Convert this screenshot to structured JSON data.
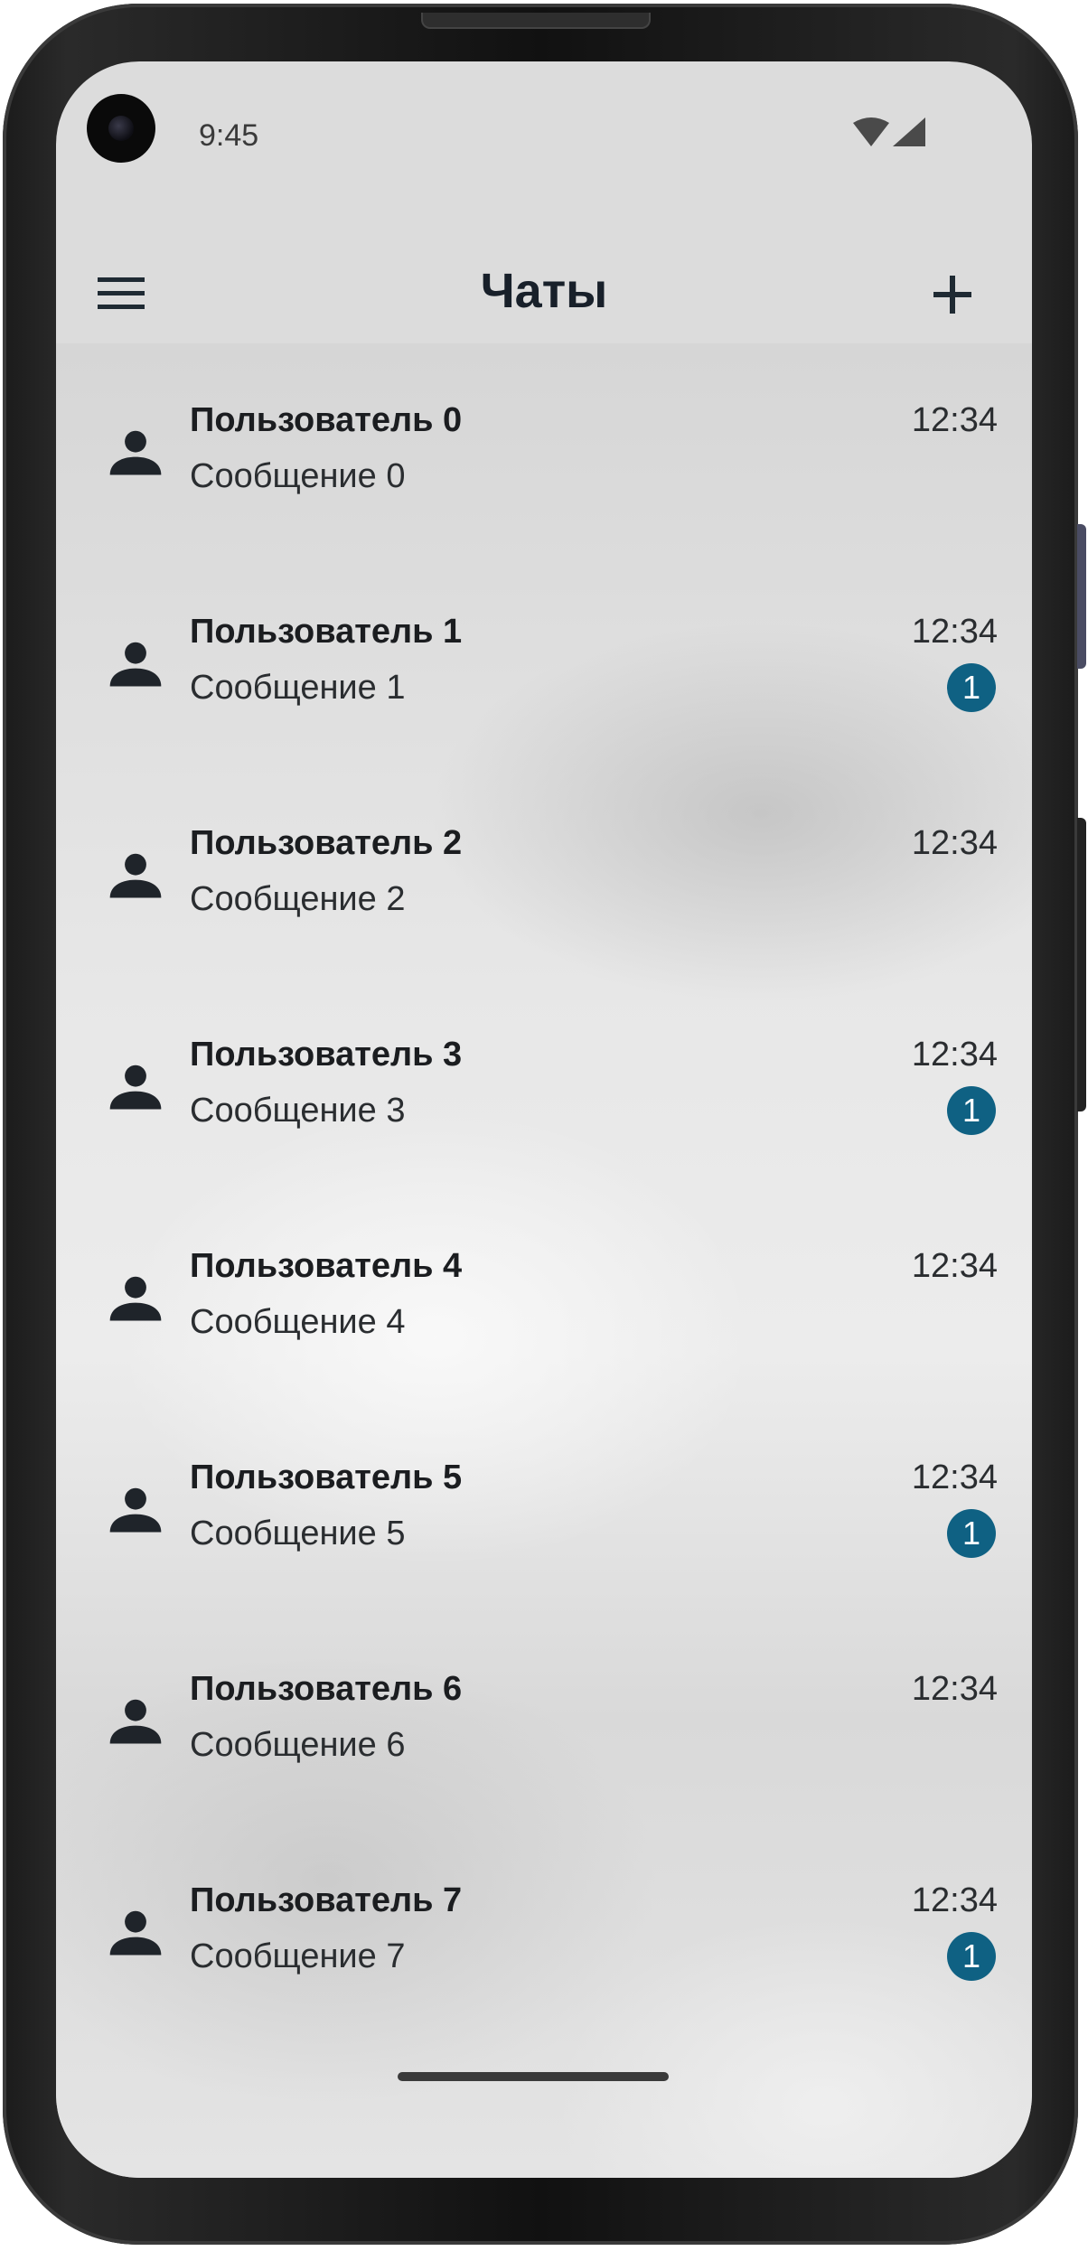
{
  "status_bar": {
    "time": "9:45"
  },
  "app_bar": {
    "title": "Чаты",
    "menu_icon": "menu-icon",
    "add_icon": "add-icon"
  },
  "colors": {
    "accent": "#0f6183",
    "title": "#18202a",
    "app_bar_bg": "#dcdcdc"
  },
  "chats": [
    {
      "name": "Пользователь 0",
      "message": "Сообщение 0",
      "time": "12:34",
      "unread": ""
    },
    {
      "name": "Пользователь 1",
      "message": "Сообщение 1",
      "time": "12:34",
      "unread": "1"
    },
    {
      "name": "Пользователь 2",
      "message": "Сообщение 2",
      "time": "12:34",
      "unread": ""
    },
    {
      "name": "Пользователь 3",
      "message": "Сообщение 3",
      "time": "12:34",
      "unread": "1"
    },
    {
      "name": "Пользователь 4",
      "message": "Сообщение 4",
      "time": "12:34",
      "unread": ""
    },
    {
      "name": "Пользователь 5",
      "message": "Сообщение 5",
      "time": "12:34",
      "unread": "1"
    },
    {
      "name": "Пользователь 6",
      "message": "Сообщение 6",
      "time": "12:34",
      "unread": ""
    },
    {
      "name": "Пользователь 7",
      "message": "Сообщение 7",
      "time": "12:34",
      "unread": "1"
    }
  ]
}
